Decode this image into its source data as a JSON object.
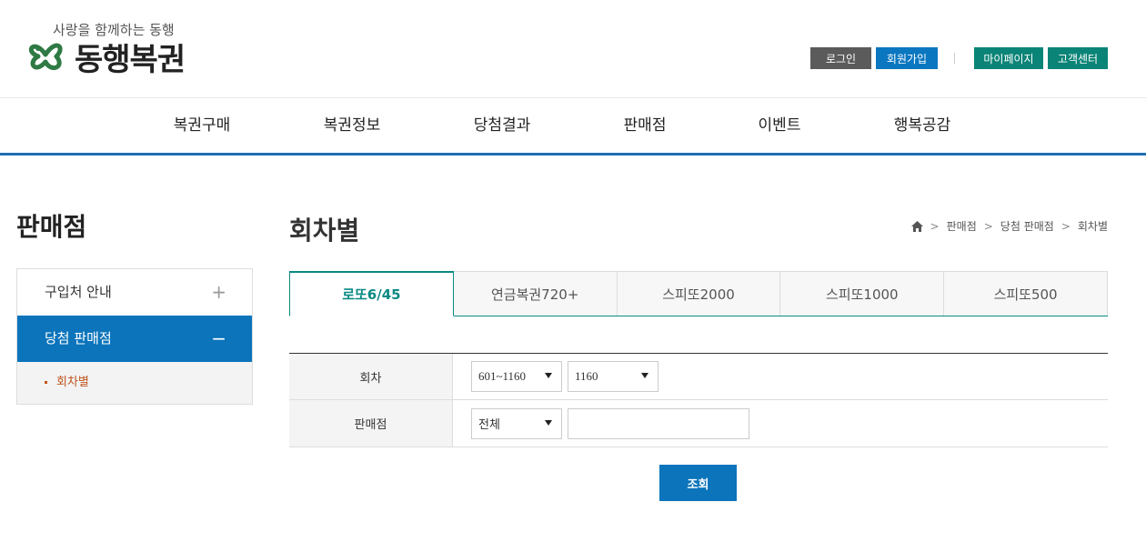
{
  "brand": {
    "slogan": "사랑을 함께하는 동행",
    "name": "동행복권",
    "colors": {
      "green": "#2f7a44",
      "blue": "#0b74bb",
      "teal": "#0a8477"
    }
  },
  "util_menu": {
    "login": "로그인",
    "join": "회원가입",
    "mypage": "마이페이지",
    "customer_center": "고객센터"
  },
  "gnb": [
    "복권구매",
    "복권정보",
    "당첨결과",
    "판매점",
    "이벤트",
    "행복공감"
  ],
  "sidebar": {
    "title": "판매점",
    "items": [
      {
        "label": "구입처 안내",
        "toggle": "+"
      },
      {
        "label": "당첨 판매점",
        "toggle": "−"
      }
    ],
    "sub_items": [
      {
        "label": "회차별"
      }
    ]
  },
  "content": {
    "title": "회차별",
    "breadcrumb": [
      "판매점",
      "당첨 판매점",
      "회차별"
    ],
    "tabs": [
      "로또6/45",
      "연금복권720+",
      "스피또2000",
      "스피또1000",
      "스피또500"
    ],
    "form": {
      "round_label": "회차",
      "round_range": "601~1160",
      "round_value": "1160",
      "store_label": "판매점",
      "store_region": "전체",
      "store_keyword": ""
    },
    "search_button": "조회"
  },
  "icons": [
    "logo-clover-icon",
    "home-icon",
    "chevron-down-icon",
    "plus-icon",
    "minus-icon"
  ]
}
